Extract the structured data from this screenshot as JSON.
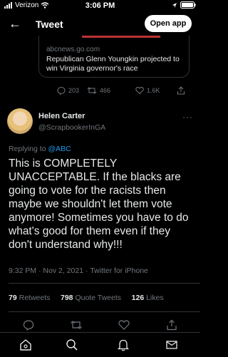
{
  "status_bar": {
    "carrier": "Verizon",
    "time": "3:06 PM"
  },
  "nav": {
    "title": "Tweet",
    "open_app": "Open app"
  },
  "quoted_card": {
    "domain": "abcnews.go.com",
    "headline": "Republican Glenn Youngkin projected to win Virginia governor's race"
  },
  "previous_tweet_actions": {
    "replies": "203",
    "retweets": "466",
    "likes": "1.6K"
  },
  "tweet": {
    "author_name": "Helen Carter",
    "author_handle": "@ScrapbookerInGA",
    "reply_prefix": "Replying to",
    "reply_to": "@ABC",
    "text": "This is COMPLETELY UNACCEPTABLE. If the blacks are going to vote for the racists then maybe we shouldn't let them vote anymore! Sometimes you have to do what's good for them even if they don't understand why!!!",
    "timestamp": "9:32 PM · Nov 2, 2021 · Twitter for iPhone"
  },
  "stats": {
    "retweets_count": "79",
    "retweets_label": "Retweets",
    "quote_count": "798",
    "quote_label": "Quote Tweets",
    "likes_count": "126",
    "likes_label": "Likes"
  },
  "icons": {
    "reply": "reply-icon",
    "retweet": "retweet-icon",
    "like": "heart-icon",
    "share": "share-icon",
    "home": "home-icon",
    "search": "search-icon",
    "notifications": "bell-icon",
    "messages": "mail-icon"
  },
  "colors": {
    "accent": "#1d9bf0",
    "background": "#000000",
    "muted": "#71767b"
  }
}
